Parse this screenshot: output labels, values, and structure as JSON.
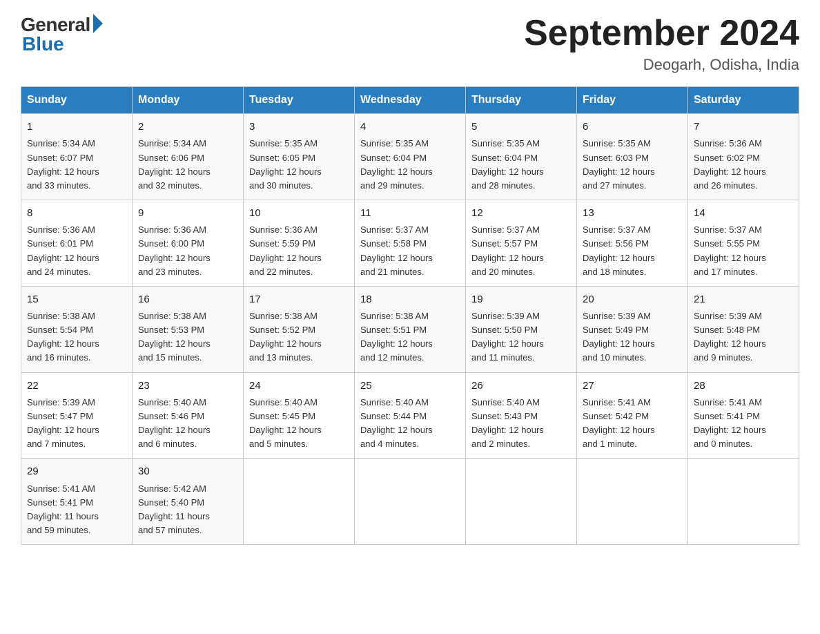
{
  "header": {
    "logo_general": "General",
    "logo_blue": "Blue",
    "month_title": "September 2024",
    "location": "Deogarh, Odisha, India"
  },
  "days_of_week": [
    "Sunday",
    "Monday",
    "Tuesday",
    "Wednesday",
    "Thursday",
    "Friday",
    "Saturday"
  ],
  "weeks": [
    [
      {
        "num": "1",
        "lines": [
          "Sunrise: 5:34 AM",
          "Sunset: 6:07 PM",
          "Daylight: 12 hours",
          "and 33 minutes."
        ]
      },
      {
        "num": "2",
        "lines": [
          "Sunrise: 5:34 AM",
          "Sunset: 6:06 PM",
          "Daylight: 12 hours",
          "and 32 minutes."
        ]
      },
      {
        "num": "3",
        "lines": [
          "Sunrise: 5:35 AM",
          "Sunset: 6:05 PM",
          "Daylight: 12 hours",
          "and 30 minutes."
        ]
      },
      {
        "num": "4",
        "lines": [
          "Sunrise: 5:35 AM",
          "Sunset: 6:04 PM",
          "Daylight: 12 hours",
          "and 29 minutes."
        ]
      },
      {
        "num": "5",
        "lines": [
          "Sunrise: 5:35 AM",
          "Sunset: 6:04 PM",
          "Daylight: 12 hours",
          "and 28 minutes."
        ]
      },
      {
        "num": "6",
        "lines": [
          "Sunrise: 5:35 AM",
          "Sunset: 6:03 PM",
          "Daylight: 12 hours",
          "and 27 minutes."
        ]
      },
      {
        "num": "7",
        "lines": [
          "Sunrise: 5:36 AM",
          "Sunset: 6:02 PM",
          "Daylight: 12 hours",
          "and 26 minutes."
        ]
      }
    ],
    [
      {
        "num": "8",
        "lines": [
          "Sunrise: 5:36 AM",
          "Sunset: 6:01 PM",
          "Daylight: 12 hours",
          "and 24 minutes."
        ]
      },
      {
        "num": "9",
        "lines": [
          "Sunrise: 5:36 AM",
          "Sunset: 6:00 PM",
          "Daylight: 12 hours",
          "and 23 minutes."
        ]
      },
      {
        "num": "10",
        "lines": [
          "Sunrise: 5:36 AM",
          "Sunset: 5:59 PM",
          "Daylight: 12 hours",
          "and 22 minutes."
        ]
      },
      {
        "num": "11",
        "lines": [
          "Sunrise: 5:37 AM",
          "Sunset: 5:58 PM",
          "Daylight: 12 hours",
          "and 21 minutes."
        ]
      },
      {
        "num": "12",
        "lines": [
          "Sunrise: 5:37 AM",
          "Sunset: 5:57 PM",
          "Daylight: 12 hours",
          "and 20 minutes."
        ]
      },
      {
        "num": "13",
        "lines": [
          "Sunrise: 5:37 AM",
          "Sunset: 5:56 PM",
          "Daylight: 12 hours",
          "and 18 minutes."
        ]
      },
      {
        "num": "14",
        "lines": [
          "Sunrise: 5:37 AM",
          "Sunset: 5:55 PM",
          "Daylight: 12 hours",
          "and 17 minutes."
        ]
      }
    ],
    [
      {
        "num": "15",
        "lines": [
          "Sunrise: 5:38 AM",
          "Sunset: 5:54 PM",
          "Daylight: 12 hours",
          "and 16 minutes."
        ]
      },
      {
        "num": "16",
        "lines": [
          "Sunrise: 5:38 AM",
          "Sunset: 5:53 PM",
          "Daylight: 12 hours",
          "and 15 minutes."
        ]
      },
      {
        "num": "17",
        "lines": [
          "Sunrise: 5:38 AM",
          "Sunset: 5:52 PM",
          "Daylight: 12 hours",
          "and 13 minutes."
        ]
      },
      {
        "num": "18",
        "lines": [
          "Sunrise: 5:38 AM",
          "Sunset: 5:51 PM",
          "Daylight: 12 hours",
          "and 12 minutes."
        ]
      },
      {
        "num": "19",
        "lines": [
          "Sunrise: 5:39 AM",
          "Sunset: 5:50 PM",
          "Daylight: 12 hours",
          "and 11 minutes."
        ]
      },
      {
        "num": "20",
        "lines": [
          "Sunrise: 5:39 AM",
          "Sunset: 5:49 PM",
          "Daylight: 12 hours",
          "and 10 minutes."
        ]
      },
      {
        "num": "21",
        "lines": [
          "Sunrise: 5:39 AM",
          "Sunset: 5:48 PM",
          "Daylight: 12 hours",
          "and 9 minutes."
        ]
      }
    ],
    [
      {
        "num": "22",
        "lines": [
          "Sunrise: 5:39 AM",
          "Sunset: 5:47 PM",
          "Daylight: 12 hours",
          "and 7 minutes."
        ]
      },
      {
        "num": "23",
        "lines": [
          "Sunrise: 5:40 AM",
          "Sunset: 5:46 PM",
          "Daylight: 12 hours",
          "and 6 minutes."
        ]
      },
      {
        "num": "24",
        "lines": [
          "Sunrise: 5:40 AM",
          "Sunset: 5:45 PM",
          "Daylight: 12 hours",
          "and 5 minutes."
        ]
      },
      {
        "num": "25",
        "lines": [
          "Sunrise: 5:40 AM",
          "Sunset: 5:44 PM",
          "Daylight: 12 hours",
          "and 4 minutes."
        ]
      },
      {
        "num": "26",
        "lines": [
          "Sunrise: 5:40 AM",
          "Sunset: 5:43 PM",
          "Daylight: 12 hours",
          "and 2 minutes."
        ]
      },
      {
        "num": "27",
        "lines": [
          "Sunrise: 5:41 AM",
          "Sunset: 5:42 PM",
          "Daylight: 12 hours",
          "and 1 minute."
        ]
      },
      {
        "num": "28",
        "lines": [
          "Sunrise: 5:41 AM",
          "Sunset: 5:41 PM",
          "Daylight: 12 hours",
          "and 0 minutes."
        ]
      }
    ],
    [
      {
        "num": "29",
        "lines": [
          "Sunrise: 5:41 AM",
          "Sunset: 5:41 PM",
          "Daylight: 11 hours",
          "and 59 minutes."
        ]
      },
      {
        "num": "30",
        "lines": [
          "Sunrise: 5:42 AM",
          "Sunset: 5:40 PM",
          "Daylight: 11 hours",
          "and 57 minutes."
        ]
      },
      {
        "num": "",
        "lines": []
      },
      {
        "num": "",
        "lines": []
      },
      {
        "num": "",
        "lines": []
      },
      {
        "num": "",
        "lines": []
      },
      {
        "num": "",
        "lines": []
      }
    ]
  ]
}
